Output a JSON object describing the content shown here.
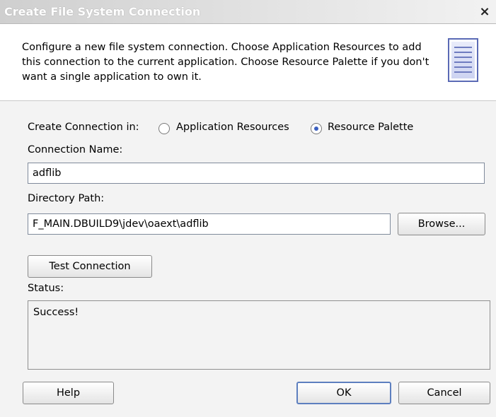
{
  "window": {
    "title": "Create File System Connection",
    "close_glyph": "×"
  },
  "description": {
    "text": "Configure a new file system connection.  Choose Application Resources to add this connection to the current application. Choose Resource Palette if you don't want a single application to own it.",
    "icon": "document-lines-icon"
  },
  "create_in": {
    "label": "Create Connection in:",
    "options": [
      {
        "label": "Application Resources",
        "checked": false
      },
      {
        "label": "Resource Palette",
        "checked": true
      }
    ]
  },
  "connection_name": {
    "label": "Connection Name:",
    "value": "adflib"
  },
  "directory_path": {
    "label": "Directory Path:",
    "value": "F_MAIN.DBUILD9\\jdev\\oaext\\adflib",
    "browse_label": "Browse..."
  },
  "test_connection": {
    "label": "Test Connection"
  },
  "status": {
    "label": "Status:",
    "value": "Success!"
  },
  "footer": {
    "help": "Help",
    "ok": "OK",
    "cancel": "Cancel"
  },
  "colors": {
    "title_text": "#ffffff",
    "radio_dot": "#3b5fbf",
    "default_button_border": "#5d7fbf"
  }
}
